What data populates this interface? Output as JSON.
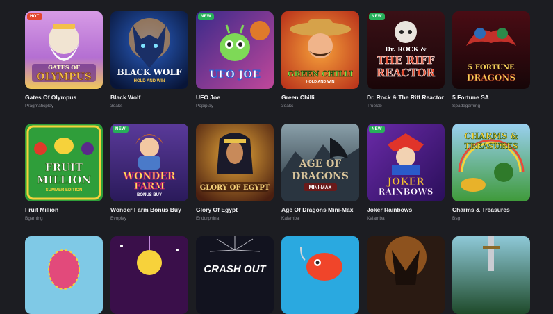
{
  "games": [
    {
      "title": "Gates Of Olympus",
      "provider": "Pragmaticplay",
      "badge": "HOT",
      "art_text": [
        "GATES OF",
        "OLYMPUS"
      ],
      "colors": [
        "#c98ad8",
        "#f3c04a"
      ]
    },
    {
      "title": "Black Wolf",
      "provider": "3oaks",
      "badge": "",
      "art_text": [
        "BLACK WOLF",
        "HOLD AND WIN"
      ],
      "colors": [
        "#0d1f4a",
        "#f2a23a"
      ]
    },
    {
      "title": "UFO Joe",
      "provider": "Popiplay",
      "badge": "NEW",
      "art_text": [
        "UFO JOE"
      ],
      "colors": [
        "#5b2a7a",
        "#7ed957"
      ]
    },
    {
      "title": "Green Chilli",
      "provider": "3oaks",
      "badge": "",
      "art_text": [
        "GREEN CHILLI",
        "HOLD AND WIN"
      ],
      "colors": [
        "#e0541f",
        "#2f8a2c"
      ]
    },
    {
      "title": "Dr. Rock & The Riff Reactor",
      "provider": "Truelab",
      "badge": "NEW",
      "art_text": [
        "Dr. ROCK &",
        "THE RIFF",
        "REACTOR"
      ],
      "colors": [
        "#2a0d12",
        "#e2492c"
      ]
    },
    {
      "title": "5 Fortune SA",
      "provider": "Spadegaming",
      "badge": "",
      "art_text": [
        "5 FORTUNE",
        "DRAGONS"
      ],
      "colors": [
        "#3a0a12",
        "#2c6bb6"
      ]
    },
    {
      "title": "Fruit Million",
      "provider": "Bgaming",
      "badge": "",
      "art_text": [
        "FRUIT",
        "MILLION",
        "SUMMER EDITION"
      ],
      "colors": [
        "#27a33a",
        "#f6d23b"
      ]
    },
    {
      "title": "Wonder Farm Bonus Buy",
      "provider": "Evoplay",
      "badge": "NEW",
      "art_text": [
        "WONDER",
        "FARM",
        "BONUS BUY"
      ],
      "colors": [
        "#3c2a6b",
        "#e8478f"
      ]
    },
    {
      "title": "Glory Of Egypt",
      "provider": "Endorphina",
      "badge": "",
      "art_text": [
        "GLORY OF EGYPT"
      ],
      "colors": [
        "#4a1f10",
        "#e8a93a"
      ]
    },
    {
      "title": "Age Of Dragons Mini-Max",
      "provider": "Kalamba",
      "badge": "",
      "art_text": [
        "AGE OF",
        "DRAGONS",
        "MINI-MAX"
      ],
      "colors": [
        "#1f2a33",
        "#b9a27a"
      ]
    },
    {
      "title": "Joker Rainbows",
      "provider": "Kalamba",
      "badge": "NEW",
      "art_text": [
        "JOKER",
        "RAINBOWS"
      ],
      "colors": [
        "#4a1a7a",
        "#f2c22e"
      ]
    },
    {
      "title": "Charms & Treasures",
      "provider": "Bsg",
      "badge": "",
      "art_text": [
        "CHARMS &",
        "TREASURES"
      ],
      "colors": [
        "#58a2d8",
        "#3f9a3a"
      ]
    },
    {
      "title": "",
      "provider": "",
      "badge": "",
      "art_text": [],
      "colors": [
        "#7fc9e6",
        "#e24a7b"
      ]
    },
    {
      "title": "",
      "provider": "",
      "badge": "",
      "art_text": [],
      "colors": [
        "#3a0f4a",
        "#f7d23b"
      ]
    },
    {
      "title": "",
      "provider": "",
      "badge": "",
      "art_text": [
        "CRASH OUT"
      ],
      "colors": [
        "#12131f",
        "#e8e8f0"
      ]
    },
    {
      "title": "",
      "provider": "",
      "badge": "",
      "art_text": [],
      "colors": [
        "#2aa9e0",
        "#f0452a"
      ]
    },
    {
      "title": "",
      "provider": "",
      "badge": "",
      "art_text": [],
      "colors": [
        "#2a1a12",
        "#f08a2a"
      ]
    },
    {
      "title": "",
      "provider": "",
      "badge": "",
      "art_text": [],
      "colors": [
        "#1f4a2a",
        "#8fc9d8"
      ]
    }
  ]
}
